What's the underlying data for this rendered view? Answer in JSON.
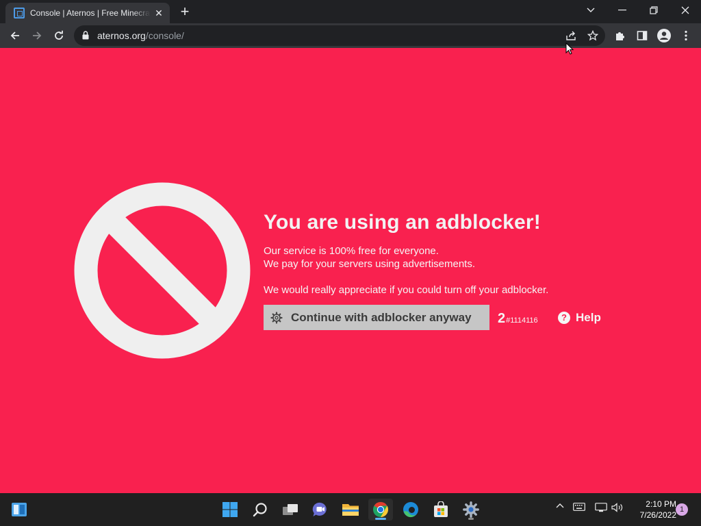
{
  "browser": {
    "tab": {
      "title": "Console | Aternos | Free Minecraft",
      "close_glyph": "✕"
    },
    "new_tab_glyph": "+",
    "url": {
      "host": "aternos.org",
      "path": "/console/"
    },
    "window_controls": [
      "chevron-down",
      "minimize",
      "restore",
      "close"
    ]
  },
  "page": {
    "background_color": "#f9214f",
    "headline": "You are using an adblocker!",
    "lines": [
      "Our service is 100% free for everyone.",
      "We pay for your servers using advertisements.",
      "We would really appreciate if you could turn off your adblocker."
    ],
    "continue_button": {
      "label": "Continue with adblocker anyway",
      "icon": "gear-icon"
    },
    "counter": {
      "number": "2",
      "code": "#1114116"
    },
    "help": {
      "icon_glyph": "?",
      "label": "Help"
    }
  },
  "taskbar": {
    "apps": [
      "windows-logo",
      "search",
      "task-view",
      "chat",
      "file-explorer",
      "chrome",
      "edge",
      "store",
      "settings"
    ],
    "active_app": "chrome",
    "clock": {
      "time": "2:10 PM",
      "date": "7/26/2022"
    },
    "notification_count": "1"
  }
}
